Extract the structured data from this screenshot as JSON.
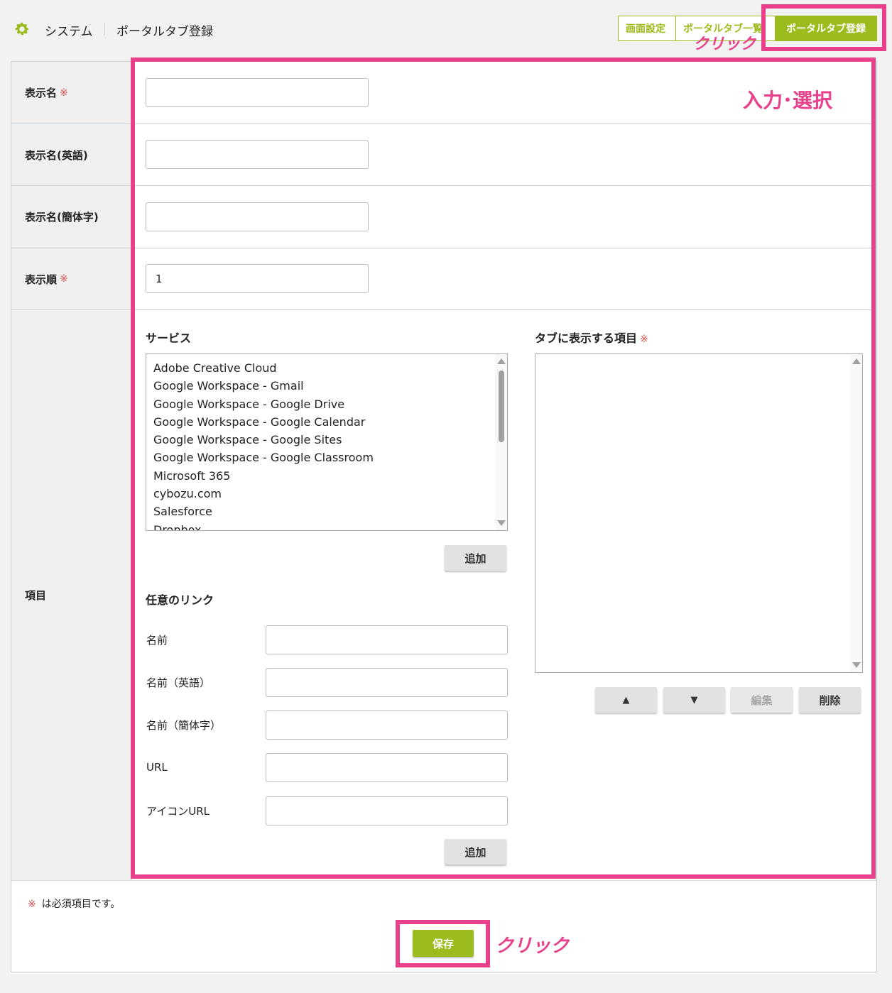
{
  "header": {
    "gear_icon": "gear-icon",
    "breadcrumb_system": "システム",
    "breadcrumb_page": "ポータルタブ登録"
  },
  "tabs": [
    {
      "label": "画面設定"
    },
    {
      "label": "ポータルタブ一覧"
    },
    {
      "label": "ポータルタブ登録"
    }
  ],
  "required_mark": "※",
  "fields": {
    "display_name_label": "表示名",
    "display_name_en_label": "表示名(英語)",
    "display_name_zh_label": "表示名(簡体字)",
    "display_order_label": "表示順",
    "display_order_value": "1",
    "items_label": "項目"
  },
  "services": {
    "title": "サービス",
    "options": [
      "Adobe Creative Cloud",
      "Google Workspace - Gmail",
      "Google Workspace - Google Drive",
      "Google Workspace - Google Calendar",
      "Google Workspace - Google Sites",
      "Google Workspace - Google Classroom",
      "Microsoft 365",
      "cybozu.com",
      "Salesforce",
      "Dropbox"
    ],
    "add_label": "追加"
  },
  "tab_items": {
    "title": "タブに表示する項目",
    "up_label": "▲",
    "down_label": "▼",
    "edit_label": "編集",
    "delete_label": "削除"
  },
  "custom_link": {
    "title": "任意のリンク",
    "name_label": "名前",
    "name_en_label": "名前（英語）",
    "name_zh_label": "名前（簡体字）",
    "url_label": "URL",
    "icon_url_label": "アイコンURL",
    "add_label": "追加"
  },
  "footer": {
    "required_note": "は必須項目です。",
    "save_label": "保存"
  },
  "annotations": {
    "click_top": "クリック",
    "input_select": "入力･選択",
    "click_bottom": "クリック"
  },
  "colors": {
    "accent": "#9cbc1d",
    "highlight": "#e8408a",
    "required": "#d9534f"
  }
}
